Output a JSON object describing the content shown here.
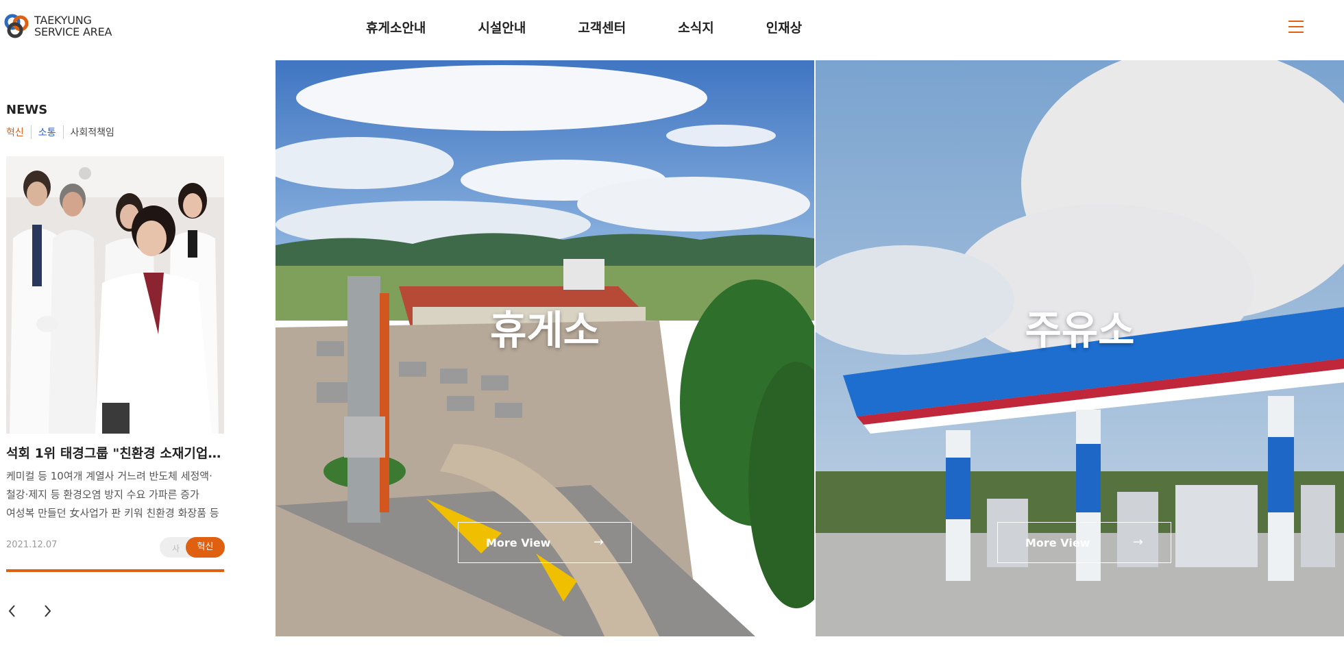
{
  "header": {
    "logo_line1": "TAEKYUNG",
    "logo_line2": "SERVICE AREA",
    "nav": [
      "휴게소안내",
      "시설안내",
      "고객센터",
      "소식지",
      "인재상"
    ],
    "menu_icon": "hamburger-icon",
    "accent_color": "#e06012"
  },
  "news": {
    "title": "NEWS",
    "tabs": [
      "혁신",
      "소통",
      "사회적책임"
    ],
    "headline": "석회 1위 태경그룹 \"친환경 소재기업으...",
    "summary": [
      "케미컬 등 10여개 계열사 거느려 반도체 세정액·",
      "철강·제지 등 환경오염 방지 수요 가파른 증가",
      "여성복 만들던 女사업가 판 키워 친환경 화장품 등"
    ],
    "date": "2021.12.07",
    "badge_ghost": "사",
    "badge": "혁신",
    "prev_icon": "chevron-left-icon",
    "next_icon": "chevron-right-icon"
  },
  "panels": [
    {
      "label": "휴게소",
      "button": "More View"
    },
    {
      "label": "주유소",
      "button": "More View"
    }
  ]
}
